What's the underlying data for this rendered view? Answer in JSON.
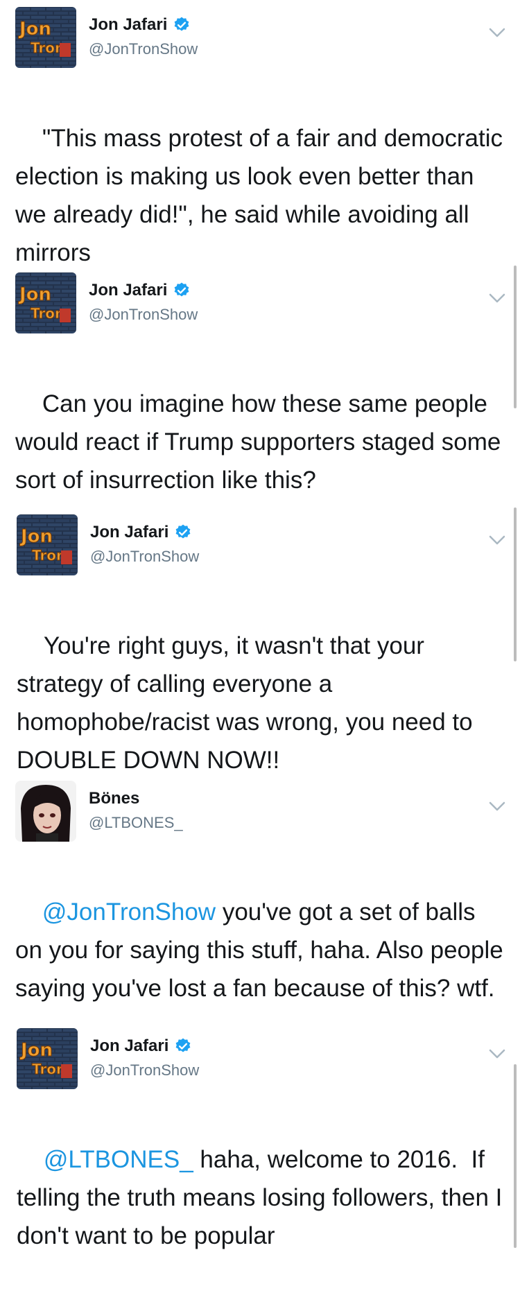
{
  "tweets": [
    {
      "display_name": "Jon Jafari",
      "handle": "@JonTronShow",
      "verified": true,
      "avatar": "jontron-show-logo",
      "mention": "",
      "text": "\"This mass protest of a fair and democratic election is making us look even better than we already did!\", he said while avoiding all mirrors"
    },
    {
      "display_name": "Jon Jafari",
      "handle": "@JonTronShow",
      "verified": true,
      "avatar": "jontron-show-logo",
      "mention": "",
      "text": "Can you imagine how these same people would react if Trump supporters staged some sort of insurrection like this?"
    },
    {
      "display_name": "Jon Jafari",
      "handle": "@JonTronShow",
      "verified": true,
      "avatar": "jontron-show-logo",
      "mention": "",
      "text": "You're right guys, it wasn't that your strategy of calling everyone a homophobe/racist was wrong, you need to DOUBLE DOWN NOW!!"
    },
    {
      "display_name": "Bönes",
      "handle": "@LTBONES_",
      "verified": false,
      "avatar": "dark-haired-portrait",
      "mention": "@JonTronShow",
      "text": " you've got a set of balls on you for saying this stuff, haha. Also people saying you've lost a fan because of this? wtf."
    },
    {
      "display_name": "Jon Jafari",
      "handle": "@JonTronShow",
      "verified": true,
      "avatar": "jontron-show-logo",
      "mention": "@LTBONES_",
      "text": " haha, welcome to 2016.  If telling the truth means losing followers, then I don't want to be popular"
    }
  ],
  "colors": {
    "text": "#14171a",
    "handle": "#657786",
    "mention": "#1b95e0",
    "verified": "#1da1f2",
    "chevron": "#aab8c2"
  },
  "icons": {
    "verified": "verified-badge-icon",
    "menu": "chevron-down-icon"
  }
}
